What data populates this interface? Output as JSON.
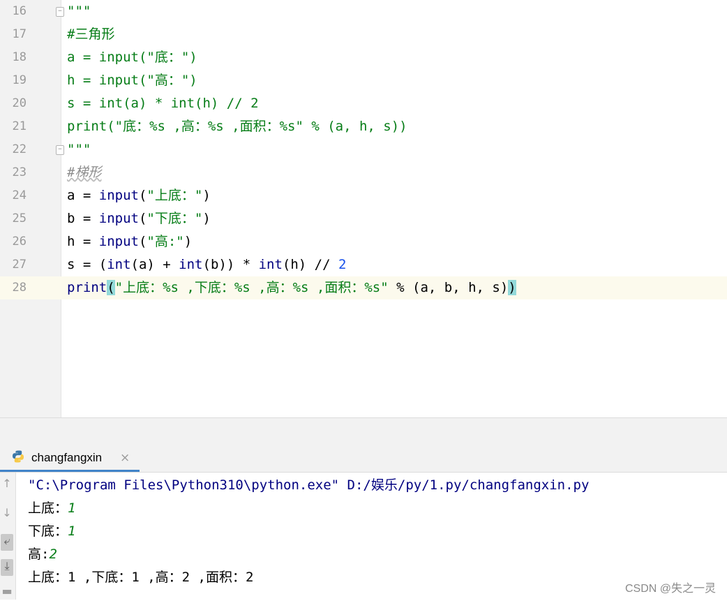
{
  "editor": {
    "lines": [
      {
        "num": "16",
        "tokens": [
          {
            "t": "\"\"\"",
            "c": "str"
          }
        ],
        "fold": true
      },
      {
        "num": "17",
        "tokens": [
          {
            "t": "#三角形",
            "c": "str"
          }
        ]
      },
      {
        "num": "18",
        "tokens": [
          {
            "t": "a = input(\"底：\")",
            "c": "str"
          }
        ]
      },
      {
        "num": "19",
        "tokens": [
          {
            "t": "h = input(\"高：\")",
            "c": "str"
          }
        ]
      },
      {
        "num": "20",
        "tokens": [
          {
            "t": "s = int(a) * int(h) // 2",
            "c": "str"
          }
        ]
      },
      {
        "num": "21",
        "tokens": [
          {
            "t": "print(\"底：%s ,高：%s ,面积：%s\" % (a, h, s))",
            "c": "str"
          }
        ]
      },
      {
        "num": "22",
        "tokens": [
          {
            "t": "\"\"\"",
            "c": "str"
          }
        ],
        "fold": true
      },
      {
        "num": "23",
        "tokens": [
          {
            "t": "#梯形",
            "c": "cmt-italic wave"
          }
        ]
      },
      {
        "num": "24",
        "tokens": [
          {
            "t": "a = ",
            "c": "plain"
          },
          {
            "t": "input",
            "c": "kw"
          },
          {
            "t": "(",
            "c": "plain"
          },
          {
            "t": "\"上底：\"",
            "c": "str"
          },
          {
            "t": ")",
            "c": "plain"
          }
        ]
      },
      {
        "num": "25",
        "tokens": [
          {
            "t": "b = ",
            "c": "plain"
          },
          {
            "t": "input",
            "c": "kw"
          },
          {
            "t": "(",
            "c": "plain"
          },
          {
            "t": "\"下底：\"",
            "c": "str"
          },
          {
            "t": ")",
            "c": "plain"
          }
        ]
      },
      {
        "num": "26",
        "tokens": [
          {
            "t": "h = ",
            "c": "plain"
          },
          {
            "t": "input",
            "c": "kw"
          },
          {
            "t": "(",
            "c": "plain"
          },
          {
            "t": "\"高:\"",
            "c": "str"
          },
          {
            "t": ")",
            "c": "plain"
          }
        ]
      },
      {
        "num": "27",
        "tokens": [
          {
            "t": "s = (",
            "c": "plain"
          },
          {
            "t": "int",
            "c": "kw"
          },
          {
            "t": "(a) + ",
            "c": "plain"
          },
          {
            "t": "int",
            "c": "kw"
          },
          {
            "t": "(b)) * ",
            "c": "plain"
          },
          {
            "t": "int",
            "c": "kw"
          },
          {
            "t": "(h) // ",
            "c": "plain"
          },
          {
            "t": "2",
            "c": "num"
          }
        ]
      },
      {
        "num": "28",
        "current": true,
        "tokens": [
          {
            "t": "print",
            "c": "kw"
          },
          {
            "t": "(",
            "c": "plain hl"
          },
          {
            "t": "\"上底：%s ,下底：%s ,高：%s ,面积：%s\"",
            "c": "str"
          },
          {
            "t": " % (a, b, h, s)",
            "c": "plain"
          },
          {
            "t": ")",
            "c": "plain hl"
          }
        ]
      }
    ]
  },
  "run_panel": {
    "tab_label": "changfangxin",
    "close_icon": "×",
    "console": [
      {
        "parts": [
          {
            "t": "\"C:\\Program Files\\Python310\\python.exe\" D:/娱乐/py/1.py/changfangxin.py",
            "c": "cmd"
          }
        ]
      },
      {
        "parts": [
          {
            "t": "上底：",
            "c": "out"
          },
          {
            "t": "1",
            "c": "inp"
          }
        ]
      },
      {
        "parts": [
          {
            "t": "下底：",
            "c": "out"
          },
          {
            "t": "1",
            "c": "inp"
          }
        ]
      },
      {
        "parts": [
          {
            "t": "高:",
            "c": "out"
          },
          {
            "t": "2",
            "c": "inp"
          }
        ]
      },
      {
        "parts": [
          {
            "t": "上底：1 ,下底：1 ,高：2 ,面积：2",
            "c": "out"
          }
        ]
      }
    ]
  },
  "watermark": "CSDN @失之一灵",
  "colors": {
    "keyword": "#000080",
    "string": "#067d17",
    "number": "#1750eb",
    "bracket_highlight": "#93d9d9",
    "current_line": "#fcfaed",
    "tab_underline": "#4083c9"
  }
}
